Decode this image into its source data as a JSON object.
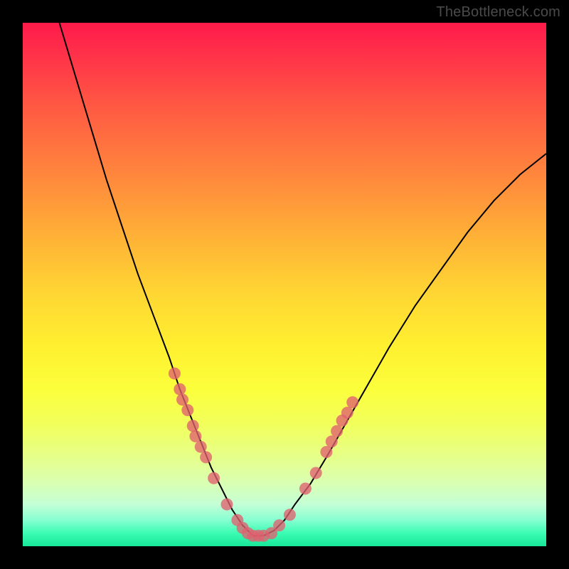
{
  "watermark": "TheBottleneck.com",
  "colors": {
    "gradient_top": "#ff1a4a",
    "gradient_bottom": "#17e79a",
    "curve": "#000000",
    "dots": "#e06070",
    "frame": "#000000"
  },
  "chart_data": {
    "type": "line",
    "title": "",
    "xlabel": "",
    "ylabel": "",
    "xlim": [
      0,
      100
    ],
    "ylim": [
      0,
      100
    ],
    "note": "Axes are normalized 0–100; gradient background encodes a qualitative good(bottom/green)→bad(top/red) scale. Curve is a V-shaped bottleneck profile with minimum near x≈44.",
    "series": [
      {
        "name": "bottleneck-curve",
        "x": [
          7,
          10,
          13,
          16,
          19,
          22,
          25,
          28,
          30,
          32,
          34,
          36,
          38,
          40,
          42,
          44,
          46,
          48,
          50,
          52,
          55,
          58,
          62,
          66,
          70,
          75,
          80,
          85,
          90,
          95,
          100
        ],
        "y": [
          100,
          90,
          80,
          70,
          61,
          52,
          44,
          36,
          30,
          25,
          20,
          15,
          11,
          7,
          4,
          2,
          2,
          3,
          5,
          8,
          12,
          17,
          24,
          31,
          38,
          46,
          53,
          60,
          66,
          71,
          75
        ]
      }
    ],
    "scatter": {
      "name": "sample-points",
      "points": [
        {
          "x": 29,
          "y": 33
        },
        {
          "x": 30,
          "y": 30
        },
        {
          "x": 30.5,
          "y": 28
        },
        {
          "x": 31.5,
          "y": 26
        },
        {
          "x": 32.5,
          "y": 23
        },
        {
          "x": 33,
          "y": 21
        },
        {
          "x": 34,
          "y": 19
        },
        {
          "x": 35,
          "y": 17
        },
        {
          "x": 36.5,
          "y": 13
        },
        {
          "x": 39,
          "y": 8
        },
        {
          "x": 41,
          "y": 5
        },
        {
          "x": 42,
          "y": 3.5
        },
        {
          "x": 43,
          "y": 2.5
        },
        {
          "x": 44,
          "y": 2
        },
        {
          "x": 45,
          "y": 2
        },
        {
          "x": 46,
          "y": 2
        },
        {
          "x": 47.5,
          "y": 2.5
        },
        {
          "x": 49,
          "y": 4
        },
        {
          "x": 51,
          "y": 6
        },
        {
          "x": 54,
          "y": 11
        },
        {
          "x": 56,
          "y": 14
        },
        {
          "x": 58,
          "y": 18
        },
        {
          "x": 59,
          "y": 20
        },
        {
          "x": 60,
          "y": 22
        },
        {
          "x": 61,
          "y": 24
        },
        {
          "x": 62,
          "y": 25.5
        },
        {
          "x": 63,
          "y": 27.5
        }
      ]
    }
  }
}
